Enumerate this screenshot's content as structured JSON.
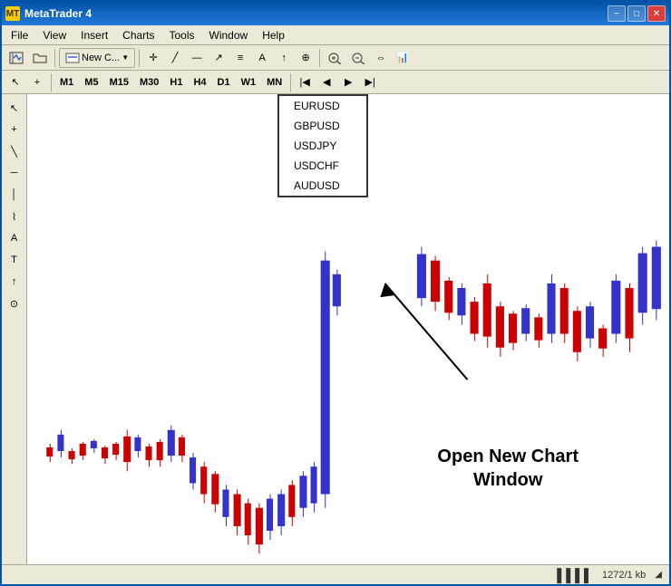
{
  "window": {
    "title": "MetaTrader 4"
  },
  "title_bar": {
    "minimize": "−",
    "maximize": "□",
    "close": "✕"
  },
  "menu": {
    "items": [
      "File",
      "View",
      "Insert",
      "Charts",
      "Tools",
      "Window",
      "Help"
    ]
  },
  "toolbar": {
    "new_btn_label": "New C...",
    "timeframes": [
      "M1",
      "M5",
      "M15",
      "M30",
      "H1",
      "H4",
      "D1",
      "W1",
      "MN"
    ]
  },
  "dropdown": {
    "items": [
      "EURUSD",
      "GBPUSD",
      "USDJPY",
      "USDCHF",
      "AUDUSD"
    ]
  },
  "annotation": {
    "line1": "Open New Chart",
    "line2": "Window"
  },
  "status_bar": {
    "info": "1272/1 kb"
  }
}
